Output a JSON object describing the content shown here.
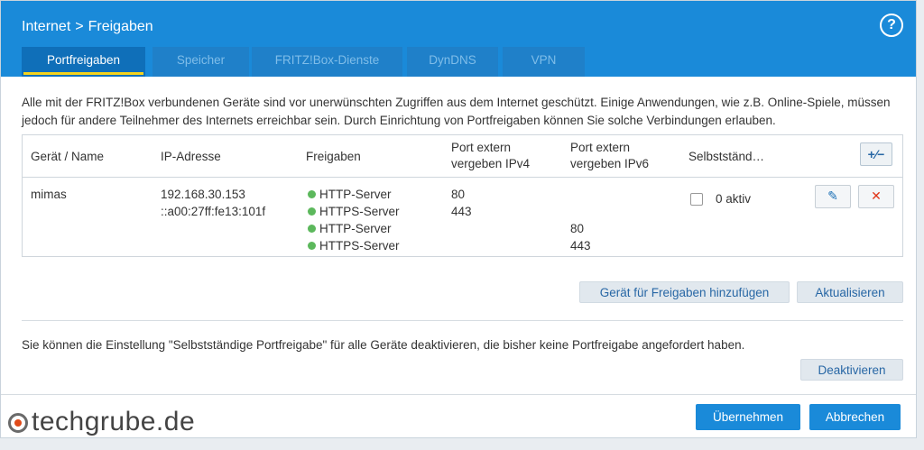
{
  "header": {
    "breadcrumb_parent": "Internet",
    "breadcrumb_sep": ">",
    "breadcrumb_current": "Freigaben",
    "help_label": "?"
  },
  "tabs": [
    {
      "label": "Portfreigaben",
      "active": true
    },
    {
      "label": "Speicher",
      "active": false
    },
    {
      "label": "FRITZ!Box-Dienste",
      "active": false
    },
    {
      "label": "DynDNS",
      "active": false
    },
    {
      "label": "VPN",
      "active": false
    }
  ],
  "intro_text": "Alle mit der FRITZ!Box verbundenen Geräte sind vor unerwünschten Zugriffen aus dem Internet geschützt. Einige Anwendungen, wie z.B. Online-Spiele, müssen jedoch für andere Teilnehmer des Internets erreichbar sein. Durch Einrichtung von Portfreigaben können Sie solche Verbindungen erlauben.",
  "table": {
    "headers": {
      "device": "Gerät / Name",
      "ip": "IP-Adresse",
      "shares": "Freigaben",
      "port_ipv4_line1": "Port extern",
      "port_ipv4_line2": "vergeben IPv4",
      "port_ipv6_line1": "Port extern",
      "port_ipv6_line2": "vergeben IPv6",
      "self": "Selbstständ…"
    },
    "toggle_button": "+⁄−",
    "row": {
      "device": "mimas",
      "ip_v4": "192.168.30.153",
      "ip_v6": "::a00:27ff:fe13:101f",
      "shares": [
        "HTTP-Server",
        "HTTPS-Server",
        "HTTP-Server",
        "HTTPS-Server"
      ],
      "ports_v4": [
        "80",
        "443"
      ],
      "ports_v6": [
        "80",
        "443"
      ],
      "self_label": "0 aktiv"
    }
  },
  "buttons": {
    "add_device": "Gerät für Freigaben hinzufügen",
    "refresh": "Aktualisieren",
    "deactivate": "Deaktivieren",
    "apply": "Übernehmen",
    "cancel": "Abbrechen"
  },
  "note_text": "Sie können die Einstellung \"Selbstständige Portfreigabe\" für alle Geräte deaktivieren, die bisher keine Portfreigabe angefordert haben.",
  "watermark": "techgrube.de",
  "colors": {
    "accent": "#1a8ad9",
    "tab_indicator": "#f5d31d",
    "status_green": "#5cb85c",
    "delete_red": "#e03418"
  }
}
